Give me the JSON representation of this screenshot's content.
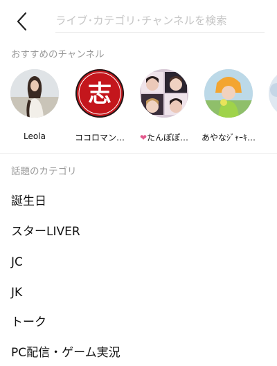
{
  "search": {
    "placeholder": "ライブ･カテゴリ･チャンネルを検索",
    "value": ""
  },
  "sections": {
    "channels_title": "おすすめのチャンネル",
    "topics_title": "話題のカテゴリ"
  },
  "channels": [
    {
      "name": "Leola"
    },
    {
      "name": "ココロマン…"
    },
    {
      "heart": "❤",
      "name": "たんぽぽ…"
    },
    {
      "name": "あやなｼﾞｬｰｷ…"
    }
  ],
  "topics": [
    {
      "label": "誕生日"
    },
    {
      "label": "スターLIVER"
    },
    {
      "label": "JC"
    },
    {
      "label": "JK"
    },
    {
      "label": "トーク"
    },
    {
      "label": "PC配信・ゲーム実況"
    }
  ],
  "colors": {
    "accent_heart": "#e35a8d",
    "seal_red": "#c4161c",
    "muted_text": "#9a9a9a"
  },
  "avatar_logo_text": "志"
}
